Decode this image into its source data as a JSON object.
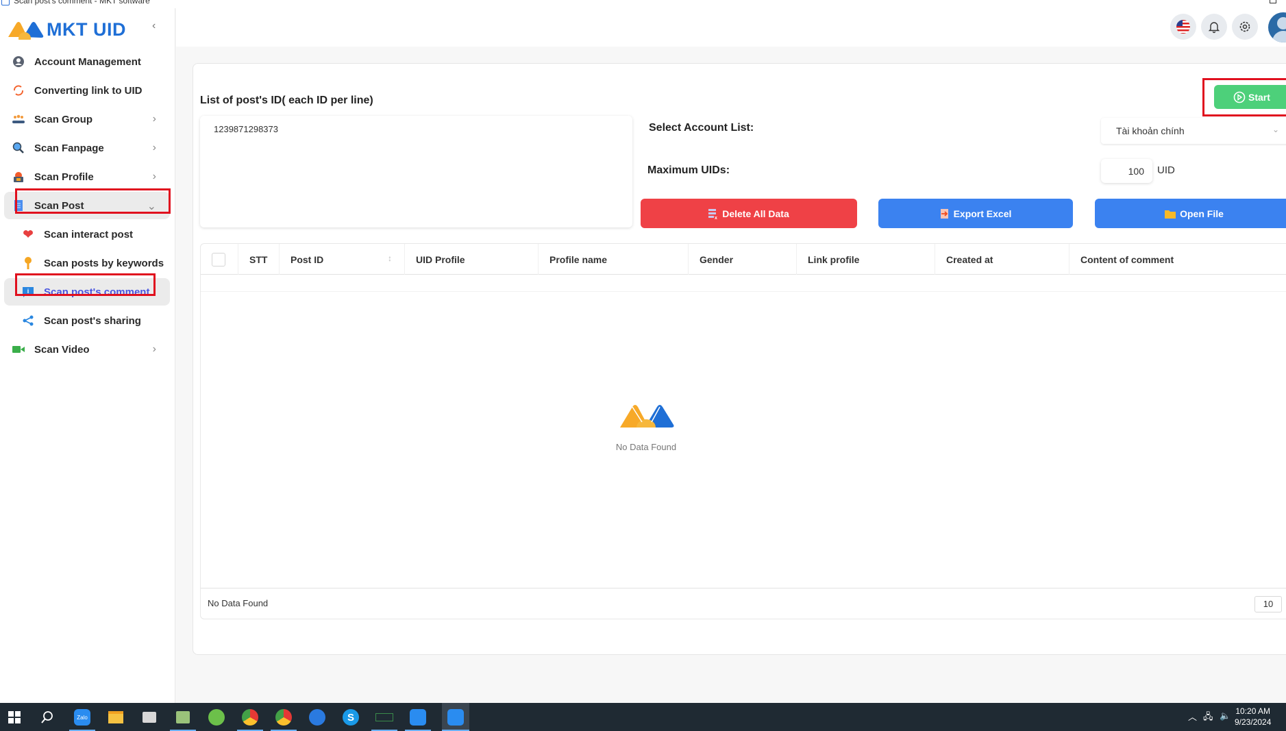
{
  "window": {
    "title": "Scan post's comment - MKT software"
  },
  "sidebar": {
    "logo_text": "MKT UID",
    "collapse_glyph": "‹",
    "items": [
      {
        "label": "Account Management",
        "icon": "user-circle-icon"
      },
      {
        "label": "Converting link to UID",
        "icon": "refresh-icon"
      },
      {
        "label": "Scan Group",
        "icon": "group-icon",
        "chevron": "›"
      },
      {
        "label": "Scan Fanpage",
        "icon": "search-icon",
        "chevron": "›"
      },
      {
        "label": "Scan Profile",
        "icon": "profile-icon",
        "chevron": "›"
      },
      {
        "label": "Scan Post",
        "icon": "document-icon",
        "chevron": "⌄",
        "expanded": true
      },
      {
        "label": "Scan interact post",
        "icon": "heart-icon",
        "sub": true
      },
      {
        "label": "Scan posts by keywords",
        "icon": "key-icon",
        "sub": true
      },
      {
        "label": "Scan post's comment",
        "icon": "comment-info-icon",
        "sub": true,
        "active": true
      },
      {
        "label": "Scan post's sharing",
        "icon": "share-icon",
        "sub": true
      },
      {
        "label": "Scan Video",
        "icon": "video-icon",
        "chevron": "›"
      }
    ]
  },
  "header": {
    "icons": [
      "us-flag-icon",
      "bell-icon",
      "gear-icon",
      "avatar"
    ]
  },
  "form": {
    "post_ids_label": "List of post's ID( each ID per line)",
    "post_ids_value": "1239871298373",
    "start_label": "Start",
    "account_list_label": "Select Account List:",
    "account_list_value": "Tài khoản chính",
    "max_uids_label": "Maximum UIDs:",
    "max_uids_value": "100",
    "max_uids_unit": "UID",
    "delete_label": "Delete All Data",
    "export_label": "Export Excel",
    "open_label": "Open File"
  },
  "colors": {
    "start": "#4dd07a",
    "delete": "#ef4146",
    "export": "#3b82f0",
    "open": "#3b82f0",
    "active_nav": "#4a55e0",
    "highlight_box": "#e0101e"
  },
  "table": {
    "columns": [
      "STT",
      "Post ID",
      "UID Profile",
      "Profile name",
      "Gender",
      "Link profile",
      "Created at",
      "Content of comment"
    ],
    "rows": [],
    "empty_text": "No Data Found",
    "footer_text": "No Data Found",
    "page_size": "10"
  },
  "taskbar": {
    "apps": [
      "windows-start-icon",
      "search-icon",
      "zalo-icon",
      "file-explorer-icon",
      "app-icon",
      "app-icon",
      "coccoc-browser-icon",
      "chrome-icon",
      "chrome-icon",
      "app-icon",
      "skype-icon",
      "app-icon",
      "zalo-mkt-icon",
      "mkt-uid-icon"
    ],
    "time": "10:20 AM",
    "date": "9/23/2024"
  }
}
